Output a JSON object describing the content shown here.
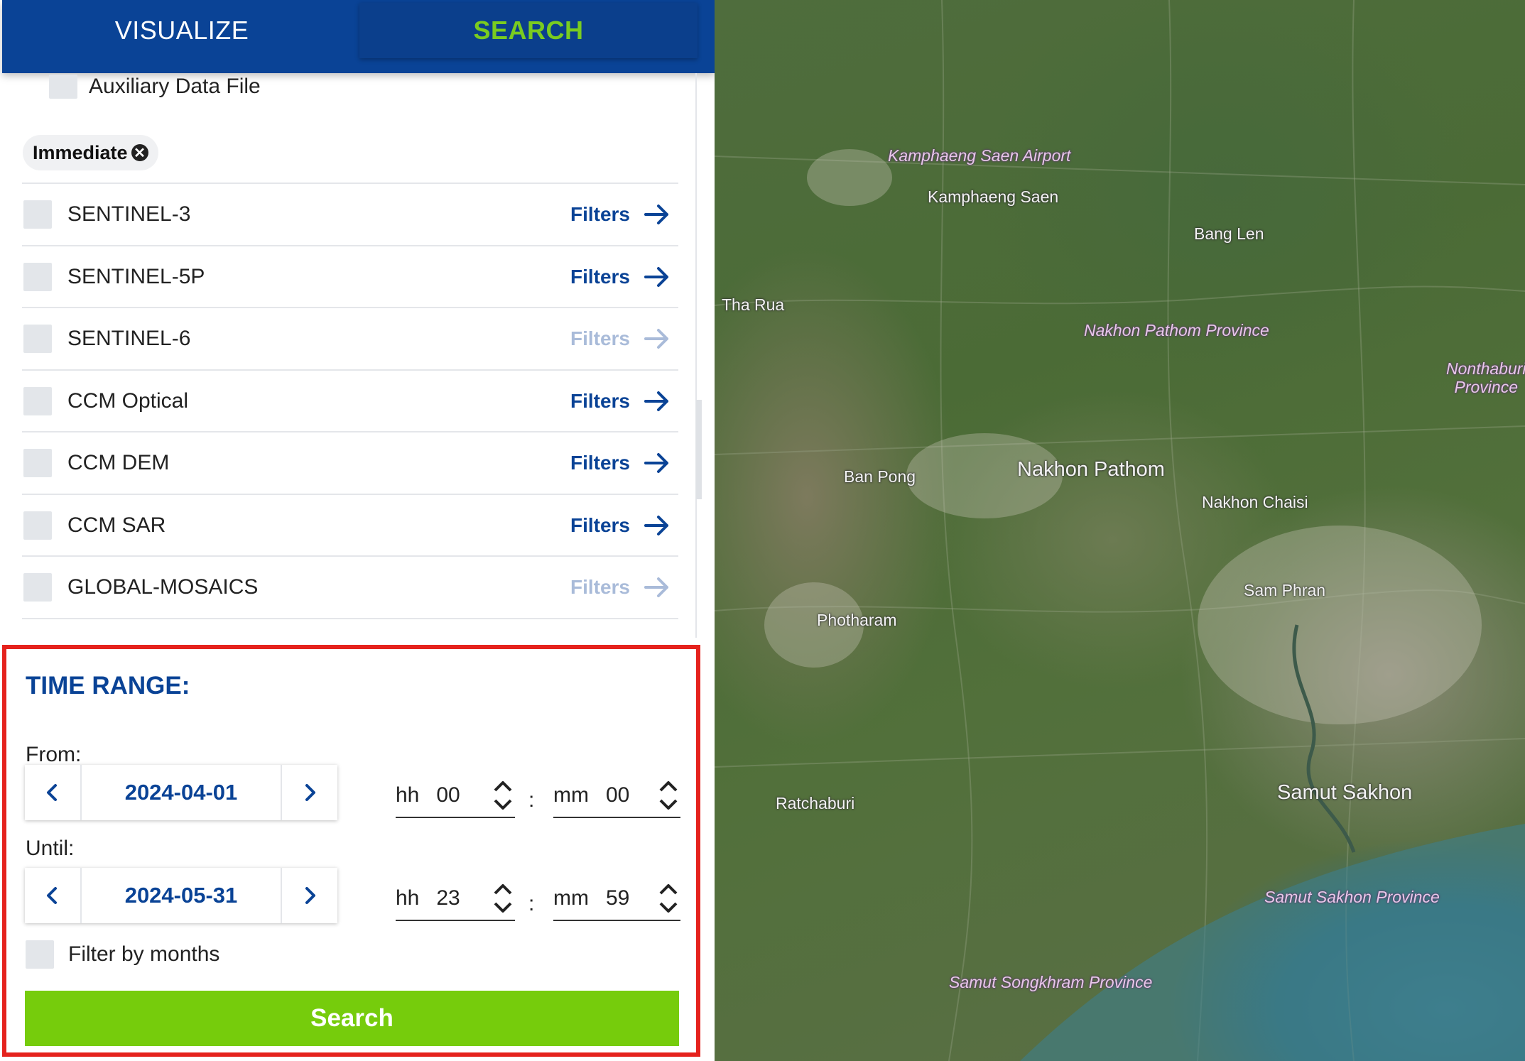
{
  "tabs": {
    "visualize": "VISUALIZE",
    "search": "SEARCH"
  },
  "aux_label": "Auxiliary Data File",
  "chip": {
    "label": "Immediate",
    "remove": "✕"
  },
  "collections": [
    {
      "name": "SENTINEL-3",
      "filters": "Filters",
      "enabled": true
    },
    {
      "name": "SENTINEL-5P",
      "filters": "Filters",
      "enabled": true
    },
    {
      "name": "SENTINEL-6",
      "filters": "Filters",
      "enabled": false
    },
    {
      "name": "CCM Optical",
      "filters": "Filters",
      "enabled": true
    },
    {
      "name": "CCM DEM",
      "filters": "Filters",
      "enabled": true
    },
    {
      "name": "CCM SAR",
      "filters": "Filters",
      "enabled": true
    },
    {
      "name": "GLOBAL-MOSAICS",
      "filters": "Filters",
      "enabled": false
    }
  ],
  "time_range": {
    "title": "TIME RANGE:",
    "from_label": "From:",
    "until_label": "Until:",
    "from": {
      "date": "2024-04-01",
      "hh_label": "hh",
      "hh": "00",
      "mm_label": "mm",
      "mm": "00"
    },
    "until": {
      "date": "2024-05-31",
      "hh_label": "hh",
      "hh": "23",
      "mm_label": "mm",
      "mm": "59"
    },
    "colon": ":",
    "filter_months": "Filter by months",
    "search_button": "Search"
  },
  "map": {
    "labels": [
      "Kamphaeng Saen Airport",
      "Kamphaeng Saen",
      "Bang Len",
      "Tha Rua",
      "Nakhon Pathom Province",
      "Nonthaburi Province",
      "Ban Pong",
      "Nakhon Pathom",
      "Nakhon Chaisi",
      "Sam Phran",
      "Photharam",
      "Ratchaburi",
      "Samut Sakhon",
      "Samut Sakhon Province",
      "Samut Songkhram Province"
    ]
  },
  "colors": {
    "brand_blue": "#0a4396",
    "accent_green": "#76cc0c",
    "highlight_red": "#e5221d"
  }
}
